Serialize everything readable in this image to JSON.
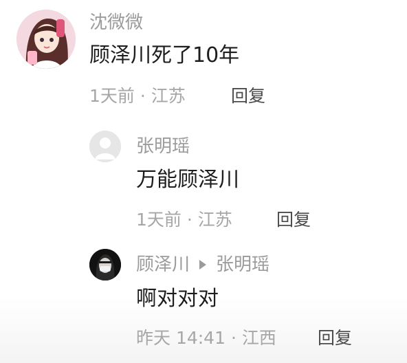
{
  "comments": [
    {
      "author": "沈微微",
      "text": "顾泽川死了10年",
      "time": "1天前 · 江苏",
      "reply_label": "回复"
    },
    {
      "author": "张明瑶",
      "text": "万能顾泽川",
      "time": "1天前 · 江苏",
      "reply_label": "回复"
    },
    {
      "author": "顾泽川",
      "reply_to": "张明瑶",
      "text": "啊对对对",
      "time": "昨天 14:41 · 江西",
      "reply_label": "回复"
    }
  ],
  "icons": {
    "avatar1": "anime-girl-avatar",
    "avatar2": "default-user-avatar",
    "avatar3": "masked-person-avatar",
    "reply_arrow": "triangle-right-icon"
  }
}
